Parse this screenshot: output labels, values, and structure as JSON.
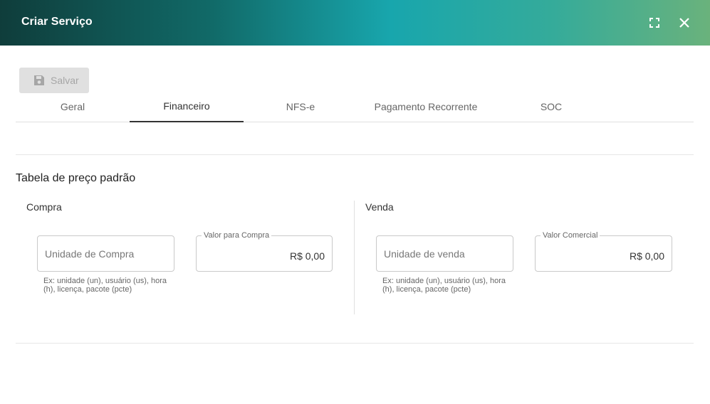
{
  "header": {
    "title": "Criar Serviço",
    "expand_icon": "fullscreen-icon",
    "close_icon": "close-icon"
  },
  "toolbar": {
    "save_label": "Salvar",
    "save_icon": "floppy-disk-icon"
  },
  "tabs": [
    {
      "label": "Geral",
      "active": false
    },
    {
      "label": "Financeiro",
      "active": true
    },
    {
      "label": "NFS-e",
      "active": false
    },
    {
      "label": "Pagamento Recorrente",
      "active": false
    },
    {
      "label": "SOC",
      "active": false
    }
  ],
  "price_table": {
    "title": "Tabela de preço padrão",
    "compra": {
      "title": "Compra",
      "unit_placeholder": "Unidade de Compra",
      "unit_helper": "Ex: unidade (un), usuário (us), hora (h), licença, pacote (pcte)",
      "value_label": "Valor para Compra",
      "value": "R$ 0,00"
    },
    "venda": {
      "title": "Venda",
      "unit_placeholder": "Unidade de venda",
      "unit_helper": "Ex: unidade (un), usuário (us), hora (h), licença, pacote (pcte)",
      "value_label": "Valor Comercial",
      "value": "R$ 0,00"
    }
  },
  "colors": {
    "header_gradient_start": "#0f3d3b",
    "header_gradient_mid": "#18a6ad",
    "header_gradient_end": "#6ab27c",
    "disabled_button": "#e0e0e0"
  }
}
